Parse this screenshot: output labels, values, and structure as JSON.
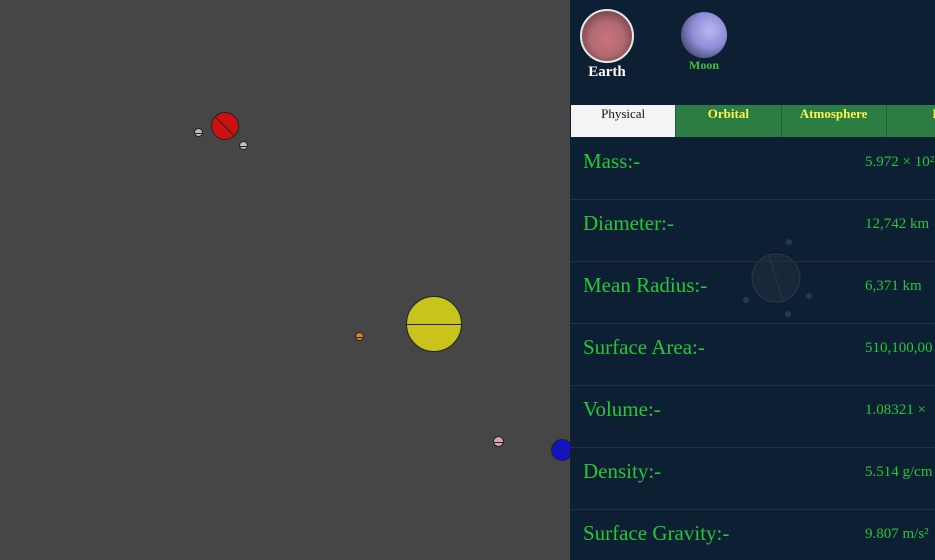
{
  "header": {
    "earth_label": "Earth",
    "moon_label": "Moon"
  },
  "tabs": [
    {
      "label": "Physical",
      "active": true
    },
    {
      "label": "Orbital",
      "active": false
    },
    {
      "label": "Atmosphere",
      "active": false
    },
    {
      "label": "Di",
      "active": false
    }
  ],
  "properties": [
    {
      "label": "Mass:-",
      "value": "5.972 × 10²"
    },
    {
      "label": "Diameter:-",
      "value": "12,742 km"
    },
    {
      "label": "Mean Radius:-",
      "value": "6,371 km"
    },
    {
      "label": "Surface Area:-",
      "value": "510,100,00"
    },
    {
      "label": "Volume:-",
      "value": "1.08321 ×"
    },
    {
      "label": "Density:-",
      "value": "5.514 g/cm"
    },
    {
      "label": "Surface Gravity:-",
      "value": "9.807 m/s²"
    }
  ],
  "colors": {
    "sim_background": "#464646",
    "panel_background": "#0d1f33",
    "label_green": "#27c63a",
    "tab_green": "#2b7d44",
    "tab_text_yellow": "#fff44a",
    "sun": "#c9c41b",
    "mars": "#cc1111",
    "earth_dot": "#1212c8"
  },
  "icons": [
    "sun-icon",
    "mars-icon",
    "moon-icon",
    "earth-icon",
    "planet-icon"
  ]
}
